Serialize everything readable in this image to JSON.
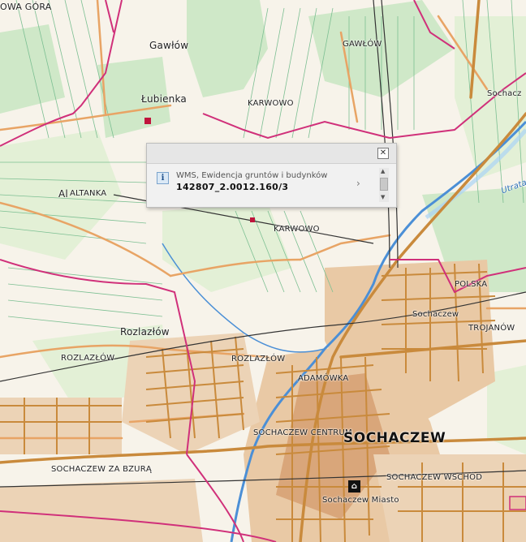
{
  "map": {
    "labels": {
      "owa_gora": "OWA GÓRA",
      "gawlow_village": "Gawłów",
      "gawlow_area": "GAWŁÓW",
      "lubienka": "Łubienka",
      "karwowo_top": "KARWOWO",
      "sochacz_edge": "Sochacz",
      "altanka": "ALTANKA",
      "altanka_prefix": "Al",
      "karwowo_mid": "KARWOWO",
      "utrata": "Utrata",
      "polska": "POLSKA",
      "sochaczew_small": "Sochaczew",
      "trojanow": "TROJANÓW",
      "rozlazlow_village": "Rozlazłów",
      "rozlazlow_left": "ROZLAZŁÓW",
      "rozlazlow_mid": "ROZLAZŁÓW",
      "adamowka": "ADAMÓWKA",
      "sochaczew_centrum": "SOCHACZEW CENTRUM",
      "sochaczew_big": "SOCHACZEW",
      "sochaczew_za_bzura": "SOCHACZEW ZA BZURĄ",
      "sochaczew_wschod": "SOCHACZEW WSCHÓD",
      "sochaczew_miasto": "Sochaczew Miasto"
    },
    "colors": {
      "background": "#f7f3ea",
      "forest": "#cfe8c8",
      "meadow": "#e3f0d6",
      "field_line": "#7cbf92",
      "road_main": "#c98a3c",
      "road_secondary": "#e8a465",
      "builtup": "#e9c9a5",
      "dense_urban": "#d9a67a",
      "admin_boundary": "#d0307a",
      "railway": "#333333",
      "river": "#4b8fd6",
      "water_fill": "#a9d3f5"
    }
  },
  "popup": {
    "layer_name": "WMS, Ewidencja gruntów i budynków",
    "parcel_id": "142807_2.0012.160/3",
    "close_label": "✕",
    "info_label": "i",
    "next_label": "›",
    "scroll_up": "▲",
    "scroll_down": "▼"
  },
  "poi": {
    "icon_label": "⌂"
  }
}
